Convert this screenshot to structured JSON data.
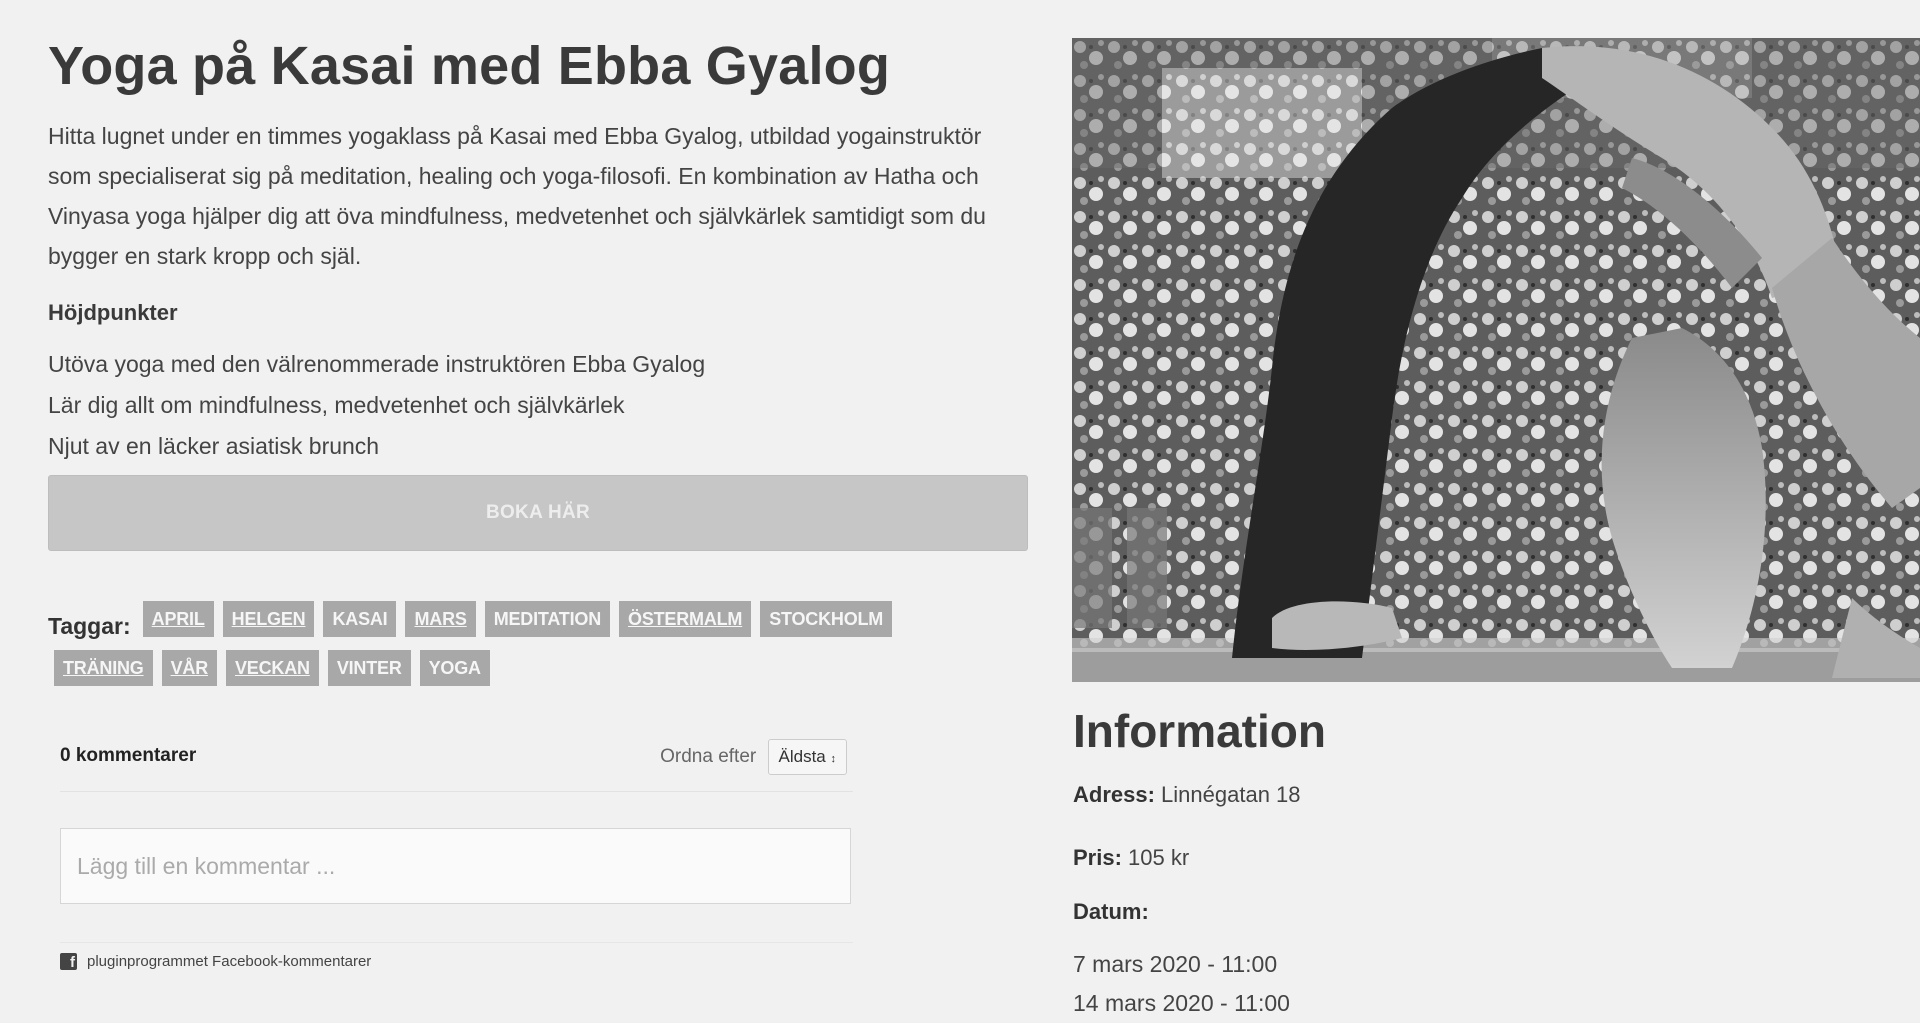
{
  "article": {
    "title": "Yoga på Kasai med Ebba Gyalog",
    "intro": "Hitta lugnet under en timmes yogaklass på Kasai med Ebba Gyalog, utbildad yogainstruktör som specialiserat sig på meditation, healing och yoga-filosofi. En kombination av Hatha och Vinyasa yoga hjälper dig att öva mindfulness, medvetenhet och självkärlek samtidigt som du bygger en stark kropp och själ.",
    "highlights_title": "Höjdpunkter",
    "highlights": [
      "Utöva yoga med den välrenommerade instruktören Ebba Gyalog",
      "Lär dig allt om mindfulness, medvetenhet och självkärlek",
      "Njut av en läcker asiatisk brunch"
    ],
    "book_label": "BOKA HÄR"
  },
  "tags": {
    "label": "Taggar:",
    "items": [
      "APRIL",
      "HELGEN",
      "KASAI",
      "MARS",
      "MEDITATION",
      "ÖSTERMALM",
      "STOCKHOLM",
      "TRÄNING",
      "VÅR",
      "VECKAN",
      "VINTER",
      "YOGA"
    ]
  },
  "comments": {
    "count_label": "0 kommentarer",
    "sort_label": "Ordna efter",
    "sort_value": "Äldsta",
    "placeholder": "Lägg till en kommentar ...",
    "plugin_label": "pluginprogrammet Facebook-kommentarer"
  },
  "info": {
    "title": "Information",
    "address_label": "Adress:",
    "address_value": "Linnégatan 18",
    "price_label": "Pris:",
    "price_value": "105 kr",
    "date_label": "Datum:",
    "dates": [
      "7 mars 2020 - 11:00",
      "14 mars 2020 - 11:00"
    ]
  },
  "icons": {
    "facebook": "facebook-icon"
  }
}
